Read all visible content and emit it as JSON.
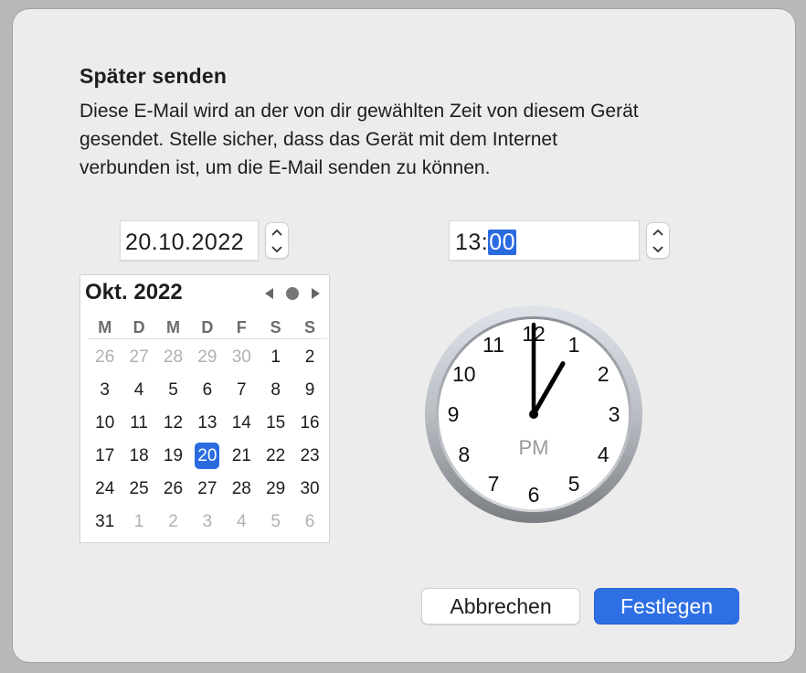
{
  "dialog": {
    "title": "Später senden",
    "description": "Diese E-Mail wird an der von dir gewählten Zeit von diesem Gerät gesendet. Stelle sicher, dass das Gerät mit dem Internet verbunden ist, um die E-Mail senden zu können."
  },
  "date_field": {
    "value": "20.10.2022"
  },
  "time_field": {
    "hours": "13:",
    "minutes": "00"
  },
  "calendar": {
    "month_label": "Okt. 2022",
    "weekdays": [
      "M",
      "D",
      "M",
      "D",
      "F",
      "S",
      "S"
    ],
    "weeks": [
      [
        {
          "d": "26",
          "o": true
        },
        {
          "d": "27",
          "o": true
        },
        {
          "d": "28",
          "o": true
        },
        {
          "d": "29",
          "o": true
        },
        {
          "d": "30",
          "o": true
        },
        {
          "d": "1"
        },
        {
          "d": "2"
        }
      ],
      [
        {
          "d": "3"
        },
        {
          "d": "4"
        },
        {
          "d": "5"
        },
        {
          "d": "6"
        },
        {
          "d": "7"
        },
        {
          "d": "8"
        },
        {
          "d": "9"
        }
      ],
      [
        {
          "d": "10"
        },
        {
          "d": "11"
        },
        {
          "d": "12"
        },
        {
          "d": "13"
        },
        {
          "d": "14"
        },
        {
          "d": "15"
        },
        {
          "d": "16"
        }
      ],
      [
        {
          "d": "17"
        },
        {
          "d": "18"
        },
        {
          "d": "19"
        },
        {
          "d": "20",
          "sel": true
        },
        {
          "d": "21"
        },
        {
          "d": "22"
        },
        {
          "d": "23"
        }
      ],
      [
        {
          "d": "24"
        },
        {
          "d": "25"
        },
        {
          "d": "26"
        },
        {
          "d": "27"
        },
        {
          "d": "28"
        },
        {
          "d": "29"
        },
        {
          "d": "30"
        }
      ],
      [
        {
          "d": "31"
        },
        {
          "d": "1",
          "o": true
        },
        {
          "d": "2",
          "o": true
        },
        {
          "d": "3",
          "o": true
        },
        {
          "d": "4",
          "o": true
        },
        {
          "d": "5",
          "o": true
        },
        {
          "d": "6",
          "o": true
        }
      ]
    ],
    "nav_icons": [
      "triangle-left-icon",
      "dot-icon",
      "triangle-right-icon"
    ]
  },
  "clock": {
    "numbers": [
      "12",
      "1",
      "2",
      "3",
      "4",
      "5",
      "6",
      "7",
      "8",
      "9",
      "10",
      "11"
    ],
    "period": "PM",
    "hour": 13,
    "minute": 0
  },
  "buttons": {
    "cancel": "Abbrechen",
    "confirm": "Festlegen"
  },
  "colors": {
    "accent": "#2f6fe4",
    "selection": "#2a6be0"
  }
}
